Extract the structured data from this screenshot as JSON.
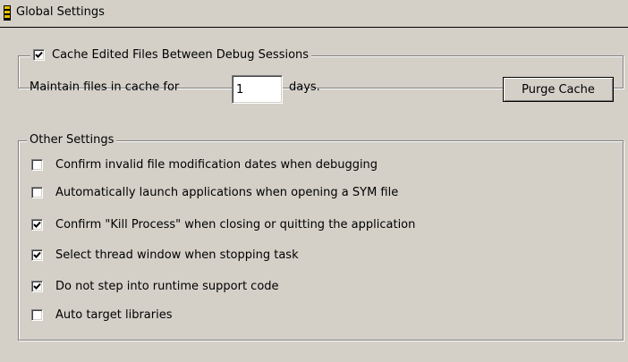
{
  "panel": {
    "title": "Global Settings"
  },
  "cache": {
    "checkbox_label": "Cache Edited Files Between Debug Sessions",
    "checked": true,
    "maintain_label": "Maintain files in cache for",
    "days_value": "1",
    "days_label": "days.",
    "purge_button": "Purge Cache"
  },
  "other": {
    "legend": "Other Settings",
    "options": [
      {
        "label": "Confirm invalid file modification dates when debugging",
        "checked": false
      },
      {
        "label": "Automatically launch applications when opening a SYM file",
        "checked": false
      },
      {
        "label": "Confirm \"Kill Process\" when closing or quitting the application",
        "checked": true
      },
      {
        "label": "Select thread window when stopping task",
        "checked": true
      },
      {
        "label": "Do not step into runtime support code",
        "checked": true
      },
      {
        "label": "Auto target libraries",
        "checked": false
      }
    ]
  }
}
